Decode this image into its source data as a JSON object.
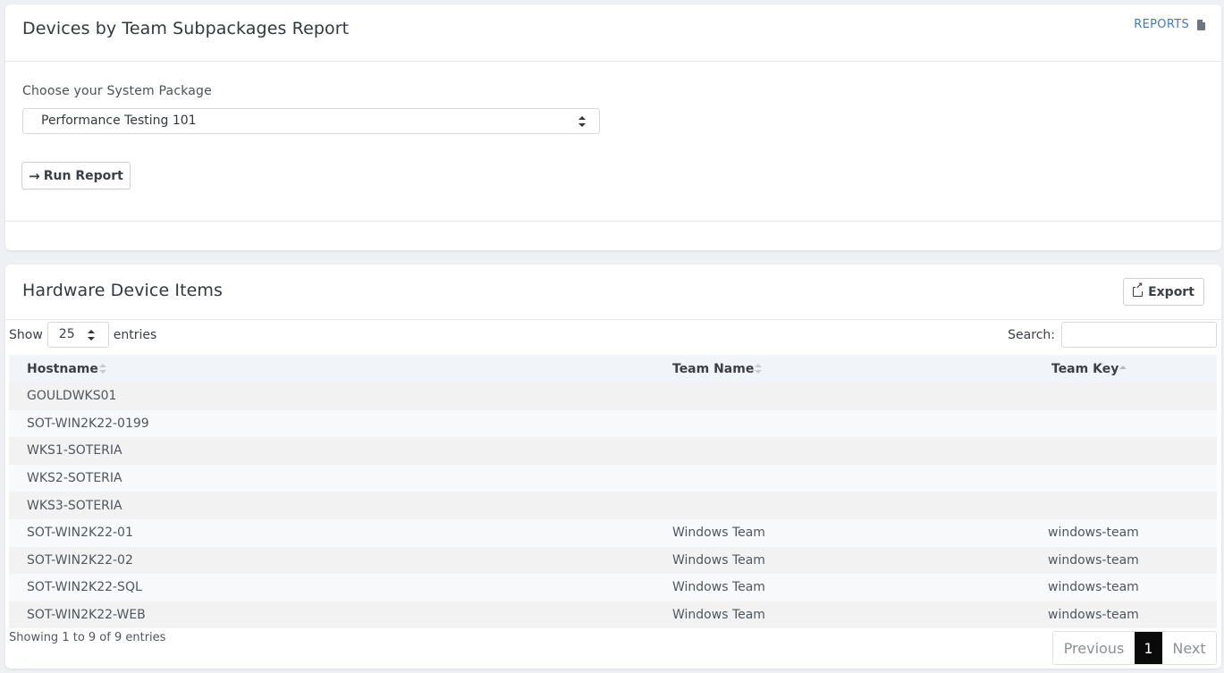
{
  "report_card": {
    "title": "Devices by Team Subpackages Report",
    "reports_link": "REPORTS",
    "package_label": "Choose your System Package",
    "selected_package": "Performance Testing 101",
    "run_button": "Run Report"
  },
  "devices_card": {
    "title": "Hardware Device Items",
    "export_button": "Export",
    "show_label": "Show",
    "entries_label": "entries",
    "page_length": "25",
    "search_label": "Search:",
    "search_value": "",
    "columns": [
      "Hostname",
      "Team Name",
      "Team Key"
    ],
    "rows": [
      {
        "hostname": "GOULDWKS01",
        "team_name": "",
        "team_key": ""
      },
      {
        "hostname": "SOT-WIN2K22-0199",
        "team_name": "",
        "team_key": ""
      },
      {
        "hostname": "WKS1-SOTERIA",
        "team_name": "",
        "team_key": ""
      },
      {
        "hostname": "WKS2-SOTERIA",
        "team_name": "",
        "team_key": ""
      },
      {
        "hostname": "WKS3-SOTERIA",
        "team_name": "",
        "team_key": ""
      },
      {
        "hostname": "SOT-WIN2K22-01",
        "team_name": "Windows Team",
        "team_key": "windows-team"
      },
      {
        "hostname": "SOT-WIN2K22-02",
        "team_name": "Windows Team",
        "team_key": "windows-team"
      },
      {
        "hostname": "SOT-WIN2K22-SQL",
        "team_name": "Windows Team",
        "team_key": "windows-team"
      },
      {
        "hostname": "SOT-WIN2K22-WEB",
        "team_name": "Windows Team",
        "team_key": "windows-team"
      }
    ],
    "info": "Showing 1 to 9 of 9 entries",
    "pagination": {
      "previous": "Previous",
      "current_page": "1",
      "next": "Next"
    }
  },
  "icons": {
    "reports": "document-icon",
    "run": "arrow-right-icon",
    "export": "external-link-icon"
  },
  "colors": {
    "link": "#3a7bc8",
    "active_page": "#0a0a0a",
    "table_header": "#f1f4f8"
  }
}
